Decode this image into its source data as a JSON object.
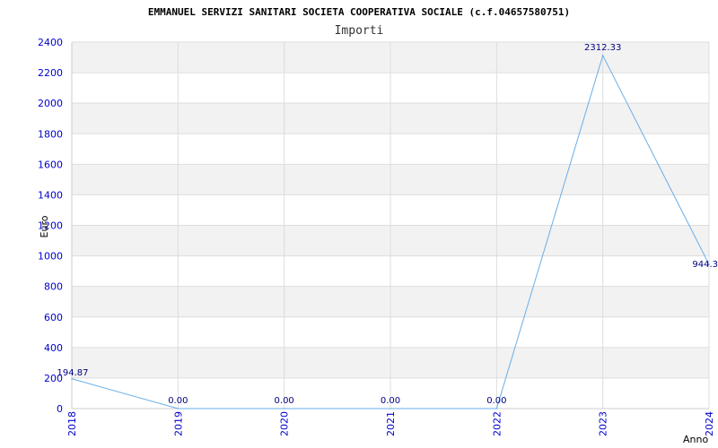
{
  "chart_data": {
    "type": "line",
    "title": "EMMANUEL SERVIZI SANITARI SOCIETA COOPERATIVA SOCIALE (c.f.04657580751)",
    "subtitle": "Importi",
    "xlabel": "Anno",
    "ylabel": "Euro",
    "x": [
      "2018",
      "2019",
      "2020",
      "2021",
      "2022",
      "2023",
      "2024"
    ],
    "values": [
      194.87,
      0.0,
      0.0,
      0.0,
      0.0,
      2312.33,
      944.3
    ],
    "value_labels": [
      "194.87",
      "0.00",
      "0.00",
      "0.00",
      "0.00",
      "2312.33",
      "944.3"
    ],
    "ylim": [
      0,
      2400
    ],
    "yticks": [
      0,
      200,
      400,
      600,
      800,
      1000,
      1200,
      1400,
      1600,
      1800,
      2000,
      2200,
      2400
    ],
    "grid": true,
    "colors": {
      "line": "#6aaee8",
      "band": "#f2f2f2",
      "grid": "#dddddd",
      "tick_text": "#0000cc",
      "label_text": "#000080"
    }
  }
}
